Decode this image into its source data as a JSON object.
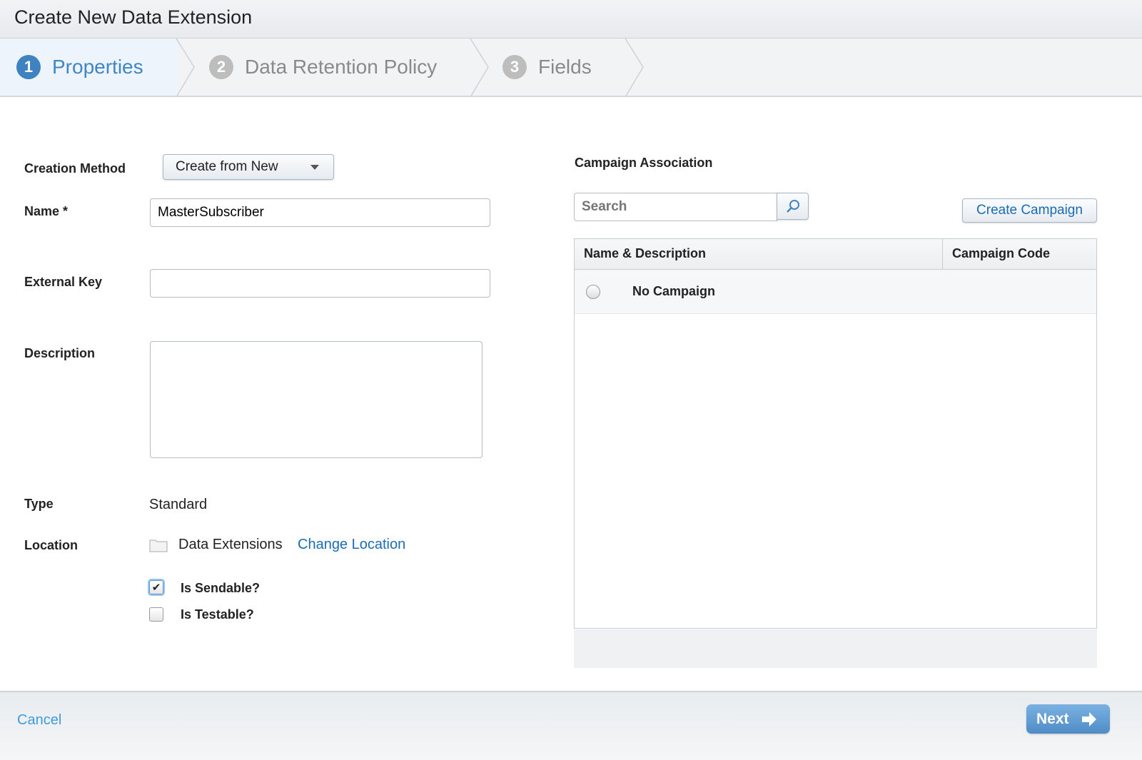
{
  "window": {
    "title": "Create New Data Extension"
  },
  "steps": [
    {
      "num": "1",
      "label": "Properties",
      "active": true
    },
    {
      "num": "2",
      "label": "Data Retention Policy"
    },
    {
      "num": "3",
      "label": "Fields"
    }
  ],
  "form": {
    "creation_method": {
      "label": "Creation Method",
      "value": "Create from New"
    },
    "name": {
      "label": "Name *",
      "value": "MasterSubscriber"
    },
    "external_key": {
      "label": "External Key",
      "value": ""
    },
    "description": {
      "label": "Description",
      "value": ""
    },
    "type": {
      "label": "Type",
      "value": "Standard"
    },
    "location": {
      "label": "Location",
      "value": "Data Extensions",
      "change_link": "Change Location",
      "icon": "folder-icon"
    },
    "is_sendable": {
      "label": "Is Sendable?",
      "checked": true
    },
    "is_testable": {
      "label": "Is Testable?",
      "checked": false
    }
  },
  "campaign": {
    "heading": "Campaign Association",
    "search_placeholder": "Search",
    "create_button": "Create Campaign",
    "columns": [
      "Name & Description",
      "Campaign Code"
    ],
    "rows": [
      {
        "name": "No Campaign",
        "code": "",
        "selected": false
      }
    ]
  },
  "footer": {
    "cancel": "Cancel",
    "next": "Next"
  },
  "colors": {
    "accent": "#3f86c6",
    "link": "#1a6cb6",
    "next_button": "#5b97cf"
  }
}
